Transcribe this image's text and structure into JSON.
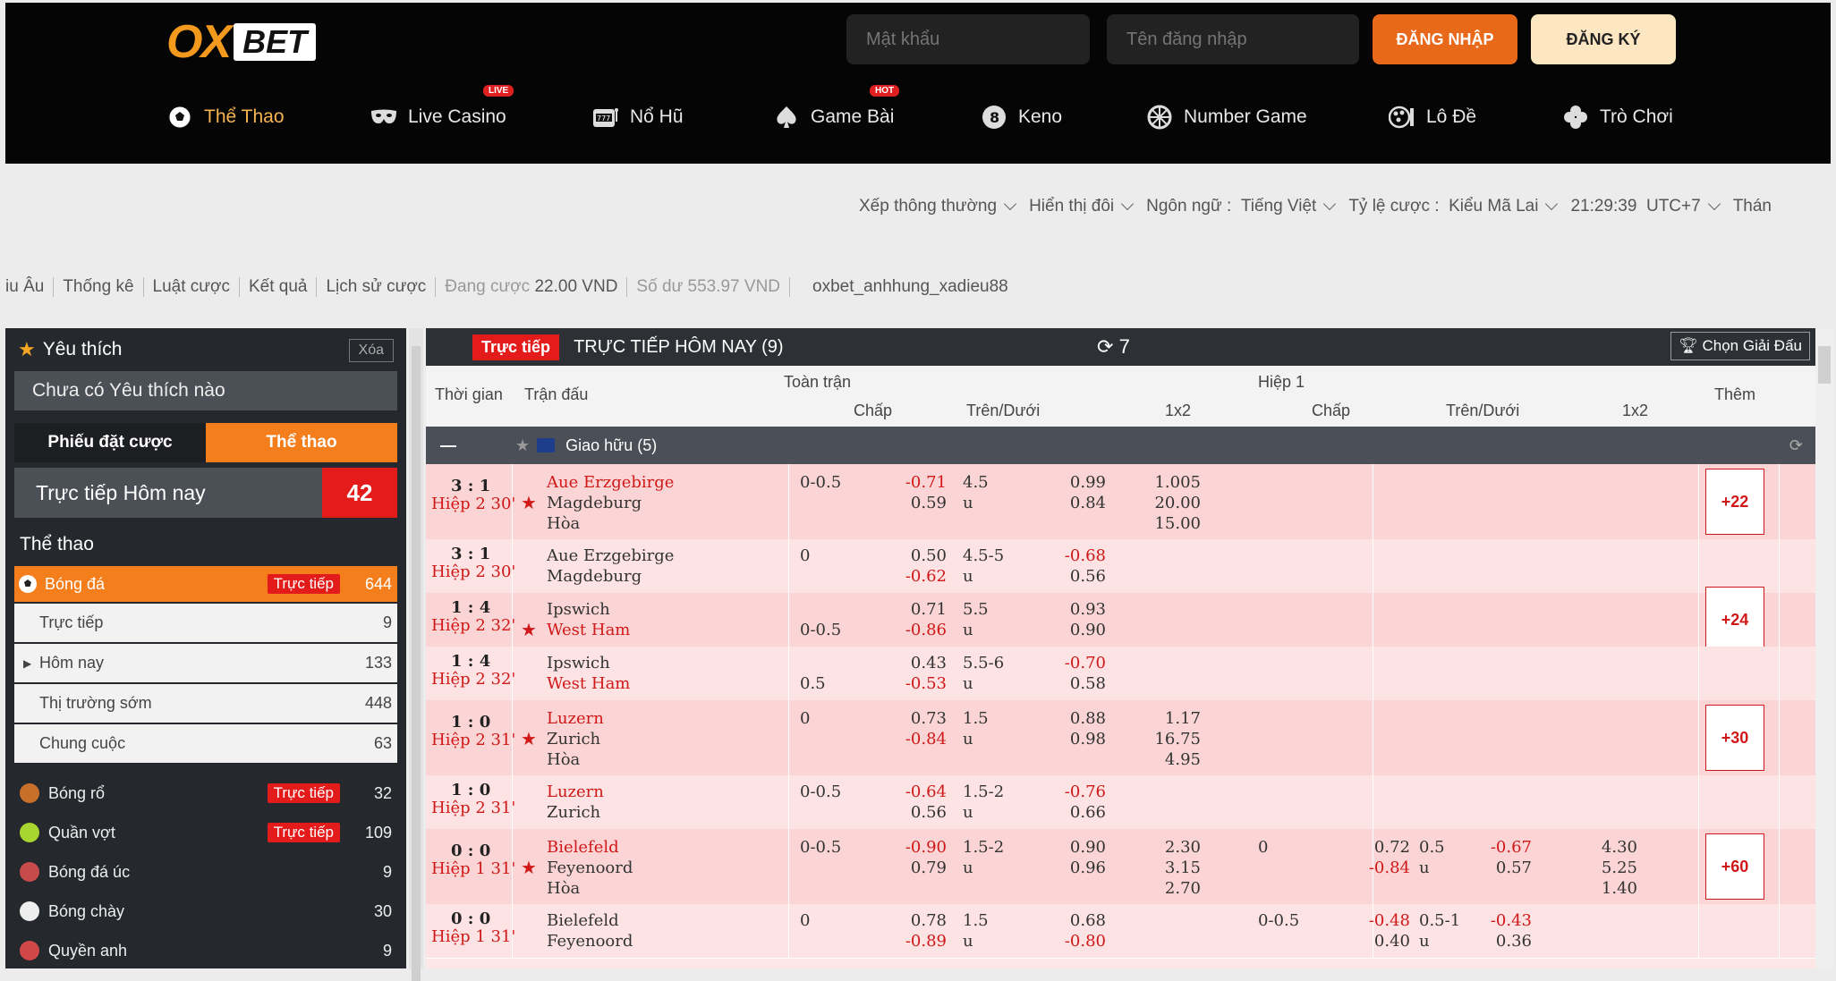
{
  "header": {
    "logo_ox": "OX",
    "logo_bet": "BET",
    "password_placeholder": "Mật khẩu",
    "username_placeholder": "Tên đăng nhập",
    "login_label": "ĐĂNG NHẬP",
    "register_label": "ĐĂNG KÝ"
  },
  "nav": [
    {
      "label": "Thể Thao",
      "icon": "soccer-ball-icon",
      "tag": ""
    },
    {
      "label": "Live Casino",
      "icon": "mask-icon",
      "tag": "LIVE"
    },
    {
      "label": "Nổ Hũ",
      "icon": "slot-machine-icon",
      "tag": ""
    },
    {
      "label": "Game Bài",
      "icon": "spade-icon",
      "tag": "HOT"
    },
    {
      "label": "Keno",
      "icon": "keno-ball-icon",
      "tag": ""
    },
    {
      "label": "Number Game",
      "icon": "wheel-icon",
      "tag": ""
    },
    {
      "label": "Lô Đề",
      "icon": "lottery-icon",
      "tag": ""
    },
    {
      "label": "Trò Chơi",
      "icon": "clover-icon",
      "tag": ""
    }
  ],
  "settings": {
    "sort": "Xếp thông thường",
    "display": "Hiển thị đôi",
    "language_label": "Ngôn ngữ :",
    "language": "Tiếng Việt",
    "odds_label": "Tỷ lệ cược :",
    "odds": "Kiểu Mã Lai",
    "time": "21:29:39",
    "tz": "UTC+7",
    "extra": "Thán"
  },
  "sublinks": {
    "l1": "iu Âu",
    "l2": "Thống kê",
    "l3": "Luật cược",
    "l4": "Kết quả",
    "l5": "Lịch sử cược",
    "betting_label": "Đang cược",
    "betting_value": "22.00 VND",
    "balance_label": "Số dư",
    "balance_value": "553.97 VND",
    "username": "oxbet_anhhung_xadieu88"
  },
  "sidebar": {
    "fav_title": "Yêu thích",
    "clear": "Xóa",
    "fav_empty": "Chưa có Yêu thích nào",
    "tab_slip": "Phiếu đặt cược",
    "tab_sports": "Thể thao",
    "live_today": "Trực tiếp Hôm nay",
    "live_today_count": "42",
    "sports_title": "Thể thao",
    "soccer": {
      "label": "Bóng đá",
      "live": "Trực tiếp",
      "count": "644"
    },
    "soccer_sub": [
      {
        "label": "Trực tiếp",
        "count": "9"
      },
      {
        "label": "Hôm nay",
        "count": "133"
      },
      {
        "label": "Thị trường sớm",
        "count": "448"
      },
      {
        "label": "Chung cuộc",
        "count": "63"
      }
    ],
    "sports": [
      {
        "label": "Bóng rổ",
        "live": "Trực tiếp",
        "count": "32",
        "color": "#c8702a"
      },
      {
        "label": "Quần vợt",
        "live": "Trực tiếp",
        "count": "109",
        "color": "#a8d530"
      },
      {
        "label": "Bóng đá úc",
        "live": "",
        "count": "9",
        "color": "#c84b4b"
      },
      {
        "label": "Bóng chày",
        "live": "",
        "count": "30",
        "color": "#eeeeee"
      },
      {
        "label": "Quyền anh",
        "live": "",
        "count": "9",
        "color": "#d04848"
      }
    ]
  },
  "main": {
    "live_badge": "Trực tiếp",
    "title": "TRỰC TIẾP HÔM NAY (9)",
    "refresh_count": "7",
    "choose_league": "Chọn Giải Đấu",
    "col_time": "Thời gian",
    "col_match": "Trận đấu",
    "col_full": "Toàn trận",
    "col_half": "Hiệp 1",
    "col_more": "Thêm",
    "sub_hdp": "Chấp",
    "sub_ou": "Trên/Dưới",
    "sub_1x2": "1x2",
    "group_minus": "—",
    "group": "Giao hữu (5)"
  },
  "matches": [
    {
      "score": "3 : 1",
      "time": "Hiệp 2 30'",
      "home": "Aue Erzgebirge",
      "away": "Magdeburg",
      "draw": "Hòa",
      "home_red": true,
      "away_red": false,
      "star": true,
      "hdp": "0-0.5",
      "hdp_top": "-0.71",
      "hdp_bot": "0.59",
      "hdp_line_row": 0,
      "ou": "4.5",
      "ou_u": "u",
      "ou_top": "0.99",
      "ou_bot": "0.84",
      "x12": [
        "1.005",
        "20.00",
        "15.00"
      ],
      "more": "+22",
      "h_hdp": "",
      "h_top": "",
      "h_bot": "",
      "h_ou": "",
      "h_u": "",
      "h_ou_top": "",
      "h_ou_bot": "",
      "h_x12": []
    },
    {
      "score": "3 : 1",
      "time": "Hiệp 2 30'",
      "home": "Aue Erzgebirge",
      "away": "Magdeburg",
      "draw": "",
      "home_red": false,
      "away_red": false,
      "star": false,
      "hdp": "0",
      "hdp_top": "0.50",
      "hdp_bot": "-0.62",
      "hdp_line_row": 0,
      "ou": "4.5-5",
      "ou_u": "u",
      "ou_top": "-0.68",
      "ou_bot": "0.56",
      "x12": [],
      "more": "",
      "h_hdp": "",
      "h_top": "",
      "h_bot": "",
      "h_ou": "",
      "h_u": "",
      "h_ou_top": "",
      "h_ou_bot": "",
      "h_x12": []
    },
    {
      "score": "1 : 4",
      "time": "Hiệp 2 32'",
      "home": "Ipswich",
      "away": "West Ham",
      "draw": "",
      "home_red": false,
      "away_red": true,
      "star": true,
      "hdp": "0-0.5",
      "hdp_top": "0.71",
      "hdp_bot": "-0.86",
      "hdp_line_row": 1,
      "ou": "5.5",
      "ou_u": "u",
      "ou_top": "0.93",
      "ou_bot": "0.90",
      "x12": [],
      "more": "+24",
      "h_hdp": "",
      "h_top": "",
      "h_bot": "",
      "h_ou": "",
      "h_u": "",
      "h_ou_top": "",
      "h_ou_bot": "",
      "h_x12": []
    },
    {
      "score": "1 : 4",
      "time": "Hiệp 2 32'",
      "home": "Ipswich",
      "away": "West Ham",
      "draw": "",
      "home_red": false,
      "away_red": true,
      "star": false,
      "hdp": "0.5",
      "hdp_top": "0.43",
      "hdp_bot": "-0.53",
      "hdp_line_row": 1,
      "ou": "5.5-6",
      "ou_u": "u",
      "ou_top": "-0.70",
      "ou_bot": "0.58",
      "x12": [],
      "more": "",
      "h_hdp": "",
      "h_top": "",
      "h_bot": "",
      "h_ou": "",
      "h_u": "",
      "h_ou_top": "",
      "h_ou_bot": "",
      "h_x12": []
    },
    {
      "score": "1 : 0",
      "time": "Hiệp 2 31'",
      "home": "Luzern",
      "away": "Zurich",
      "draw": "Hòa",
      "home_red": true,
      "away_red": false,
      "star": true,
      "hdp": "0",
      "hdp_top": "0.73",
      "hdp_bot": "-0.84",
      "hdp_line_row": 0,
      "ou": "1.5",
      "ou_u": "u",
      "ou_top": "0.88",
      "ou_bot": "0.98",
      "x12": [
        "1.17",
        "16.75",
        "4.95"
      ],
      "more": "+30",
      "h_hdp": "",
      "h_top": "",
      "h_bot": "",
      "h_ou": "",
      "h_u": "",
      "h_ou_top": "",
      "h_ou_bot": "",
      "h_x12": []
    },
    {
      "score": "1 : 0",
      "time": "Hiệp 2 31'",
      "home": "Luzern",
      "away": "Zurich",
      "draw": "",
      "home_red": true,
      "away_red": false,
      "star": false,
      "hdp": "0-0.5",
      "hdp_top": "-0.64",
      "hdp_bot": "0.56",
      "hdp_line_row": 0,
      "ou": "1.5-2",
      "ou_u": "u",
      "ou_top": "-0.76",
      "ou_bot": "0.66",
      "x12": [],
      "more": "",
      "h_hdp": "",
      "h_top": "",
      "h_bot": "",
      "h_ou": "",
      "h_u": "",
      "h_ou_top": "",
      "h_ou_bot": "",
      "h_x12": []
    },
    {
      "score": "0 : 0",
      "time": "Hiệp 1 31'",
      "home": "Bielefeld",
      "away": "Feyenoord",
      "draw": "Hòa",
      "home_red": true,
      "away_red": false,
      "star": true,
      "hdp": "0-0.5",
      "hdp_top": "-0.90",
      "hdp_bot": "0.79",
      "hdp_line_row": 0,
      "ou": "1.5-2",
      "ou_u": "u",
      "ou_top": "0.90",
      "ou_bot": "0.96",
      "x12": [
        "2.30",
        "3.15",
        "2.70"
      ],
      "more": "+60",
      "h_hdp": "0",
      "h_top": "0.72",
      "h_bot": "-0.84",
      "h_ou": "0.5",
      "h_u": "u",
      "h_ou_top": "-0.67",
      "h_ou_bot": "0.57",
      "h_x12": [
        "4.30",
        "5.25",
        "1.40"
      ]
    },
    {
      "score": "0 : 0",
      "time": "Hiệp 1 31'",
      "home": "Bielefeld",
      "away": "Feyenoord",
      "draw": "",
      "home_red": false,
      "away_red": false,
      "star": false,
      "hdp": "0",
      "hdp_top": "0.78",
      "hdp_bot": "-0.89",
      "hdp_line_row": 0,
      "ou": "1.5",
      "ou_u": "u",
      "ou_top": "0.68",
      "ou_bot": "-0.80",
      "x12": [],
      "more": "",
      "h_hdp": "0-0.5",
      "h_top": "-0.48",
      "h_bot": "0.40",
      "h_ou": "0.5-1",
      "h_u": "u",
      "h_ou_top": "-0.43",
      "h_ou_bot": "0.36",
      "h_x12": []
    }
  ]
}
